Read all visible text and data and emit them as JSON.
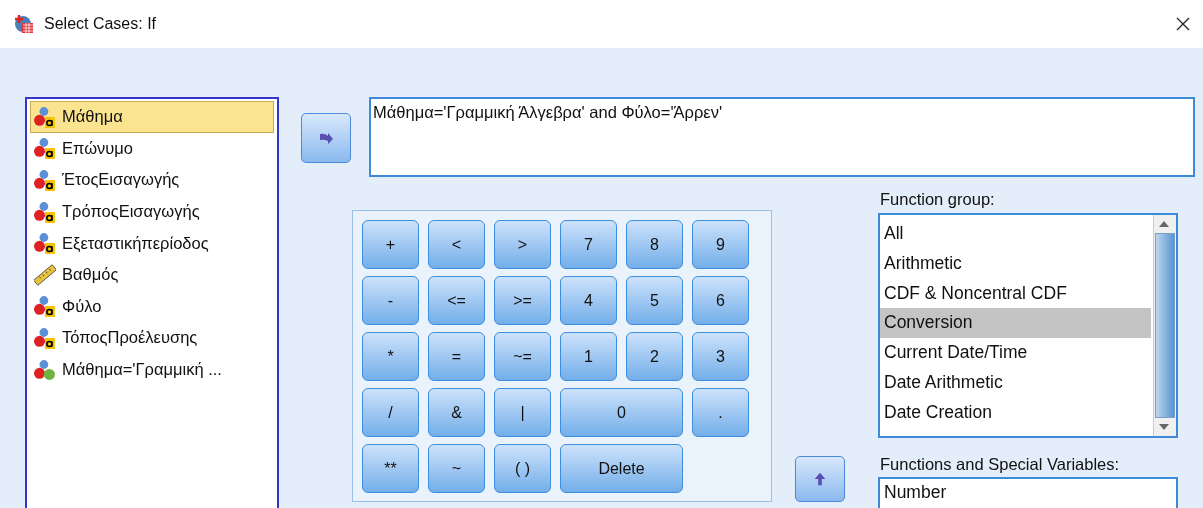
{
  "window": {
    "title": "Select Cases: If"
  },
  "variables": [
    {
      "name": "Μάθημα",
      "kind": "nominal",
      "selected": true
    },
    {
      "name": "Επώνυμο",
      "kind": "nominal",
      "selected": false
    },
    {
      "name": "ΈτοςΕισαγωγής",
      "kind": "nominal",
      "selected": false
    },
    {
      "name": "ΤρόποςΕισαγωγής",
      "kind": "nominal",
      "selected": false
    },
    {
      "name": "Εξεταστικήπερίοδος",
      "kind": "nominal",
      "selected": false
    },
    {
      "name": "Βαθμός",
      "kind": "scale",
      "selected": false
    },
    {
      "name": "Φύλο",
      "kind": "nominal",
      "selected": false
    },
    {
      "name": "ΤόποςΠροέλευσης",
      "kind": "nominal",
      "selected": false
    },
    {
      "name": "Μάθημα='Γραμμική ...",
      "kind": "filter",
      "selected": false
    }
  ],
  "expression": "Μάθημα='Γραμμική Άλγεβρα' and Φύλο='Άρρεν'",
  "keypad": [
    {
      "label": "+"
    },
    {
      "label": "<"
    },
    {
      "label": ">"
    },
    {
      "label": "7"
    },
    {
      "label": "8"
    },
    {
      "label": "9"
    },
    {
      "label": "-"
    },
    {
      "label": "<="
    },
    {
      "label": ">="
    },
    {
      "label": "4"
    },
    {
      "label": "5"
    },
    {
      "label": "6"
    },
    {
      "label": "*"
    },
    {
      "label": "="
    },
    {
      "label": "~="
    },
    {
      "label": "1"
    },
    {
      "label": "2"
    },
    {
      "label": "3"
    },
    {
      "label": "/"
    },
    {
      "label": "&"
    },
    {
      "label": "|"
    },
    {
      "label": "0",
      "wide": true
    },
    {
      "label": "."
    },
    {
      "label": "**"
    },
    {
      "label": "~"
    },
    {
      "label": "( )"
    },
    {
      "label": "Delete",
      "wide": true
    }
  ],
  "function_group": {
    "label": "Function group:",
    "items": [
      {
        "label": "All",
        "selected": false
      },
      {
        "label": "Arithmetic",
        "selected": false
      },
      {
        "label": "CDF & Noncentral CDF",
        "selected": false
      },
      {
        "label": "Conversion",
        "selected": true
      },
      {
        "label": "Current Date/Time",
        "selected": false
      },
      {
        "label": "Date Arithmetic",
        "selected": false
      },
      {
        "label": "Date Creation",
        "selected": false
      }
    ]
  },
  "functions": {
    "label": "Functions and Special Variables:",
    "items": [
      "Number"
    ]
  }
}
